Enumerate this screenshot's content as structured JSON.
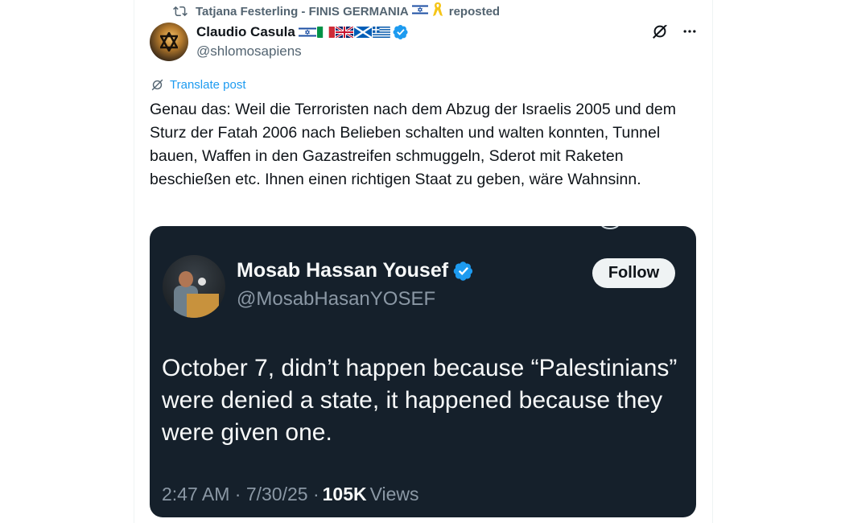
{
  "repost": {
    "user": "Tatjana Festerling - FINIS GERMANIA",
    "suffix": "reposted"
  },
  "author": {
    "name": "Claudio Casula",
    "handle": "@shlomosapiens",
    "flags": [
      "israel",
      "italy",
      "uk",
      "scotland",
      "greece"
    ]
  },
  "translate_label": "Translate post",
  "post_text": "Genau das: Weil die Terroristen nach dem Abzug der Israelis 2005 und dem Sturz der Fatah 2006 nach Belieben schalten und walten konnten, Tunnel bauen, Waffen in den Gazastreifen schmuggeln, Sderot mit Raketen beschießen etc. Ihnen einen richtigen Staat zu geben, wäre Wahnsinn.",
  "embedded": {
    "name": "Mosab Hassan Yousef",
    "handle": "@MosabHasanYOSEF",
    "follow_label": "Follow",
    "text": "October 7, didn’t happen because “Palestinians” were denied a state, it happened because they were given one.",
    "time": "2:47 AM · 7/30/25 ·",
    "views_count": "105K",
    "views_label": "Views"
  },
  "colors": {
    "accent": "#1d9bf0",
    "secondary_text": "#536471",
    "embed_bg": "#15202b"
  }
}
